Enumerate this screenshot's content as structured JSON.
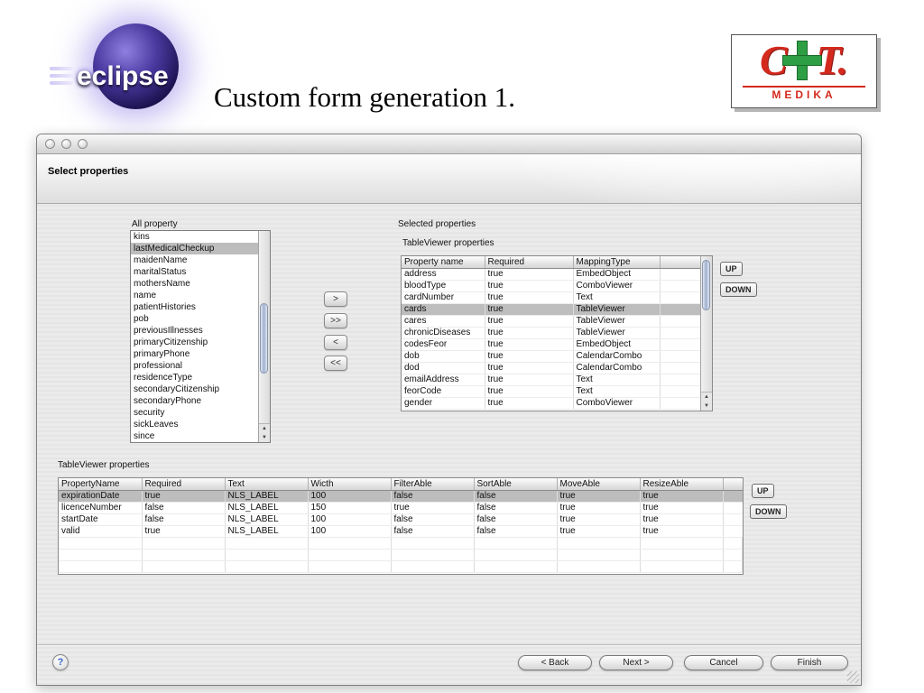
{
  "header": {
    "eclipse_text": "eclipse",
    "slide_title": "Custom form generation 1.",
    "medika": {
      "c": "C",
      "t": "T.",
      "name": "MEDIKA"
    }
  },
  "dialog": {
    "step_title": "Select properties",
    "all_property": {
      "label": "All property",
      "selected": "lastMedicalCheckup",
      "items": [
        "kins",
        "lastMedicalCheckup",
        "maidenName",
        "maritalStatus",
        "mothersName",
        "name",
        "patientHistories",
        "pob",
        "previousIllnesses",
        "primaryCitizenship",
        "primaryPhone",
        "professional",
        "residenceType",
        "secondaryCitizenship",
        "secondaryPhone",
        "security",
        "sickLeaves",
        "since"
      ]
    },
    "transfer": {
      "add": ">",
      "add_all": ">>",
      "remove": "<",
      "remove_all": "<<"
    },
    "selected_properties": {
      "label": "Selected properties",
      "table_label": "TableViewer properties",
      "up_label": "UP",
      "down_label": "DOWN",
      "table": {
        "columns": [
          "Property name",
          "Required",
          "MappingType"
        ],
        "selected": "cards",
        "empty_rows": 0,
        "rows": [
          [
            "address",
            "true",
            "EmbedObject"
          ],
          [
            "bloodType",
            "true",
            "ComboViewer"
          ],
          [
            "cardNumber",
            "true",
            "Text"
          ],
          [
            "cards",
            "true",
            "TableViewer"
          ],
          [
            "cares",
            "true",
            "TableViewer"
          ],
          [
            "chronicDiseases",
            "true",
            "TableViewer"
          ],
          [
            "codesFeor",
            "true",
            "EmbedObject"
          ],
          [
            "dob",
            "true",
            "CalendarCombo"
          ],
          [
            "dod",
            "true",
            "CalendarCombo"
          ],
          [
            "emailAddress",
            "true",
            "Text"
          ],
          [
            "feorCode",
            "true",
            "Text"
          ],
          [
            "gender",
            "true",
            "ComboViewer"
          ]
        ]
      }
    },
    "detail": {
      "label": "TableViewer properties",
      "up_label": "UP",
      "down_label": "DOWN",
      "table": {
        "columns": [
          "PropertyName",
          "Required",
          "Text",
          "Wicth",
          "FilterAble",
          "SortAble",
          "MoveAble",
          "ResizeAble"
        ],
        "selected": "expirationDate",
        "empty_rows": 3,
        "rows": [
          [
            "expirationDate",
            "true",
            "NLS_LABEL",
            "100",
            "false",
            "false",
            "true",
            "true"
          ],
          [
            "licenceNumber",
            "false",
            "NLS_LABEL",
            "150",
            "true",
            "false",
            "true",
            "true"
          ],
          [
            "startDate",
            "false",
            "NLS_LABEL",
            "100",
            "false",
            "false",
            "true",
            "true"
          ],
          [
            "valid",
            "true",
            "NLS_LABEL",
            "100",
            "false",
            "false",
            "true",
            "true"
          ]
        ]
      }
    },
    "footer": {
      "help": "?",
      "back": "< Back",
      "next": "Next >",
      "cancel": "Cancel",
      "finish": "Finish"
    }
  }
}
